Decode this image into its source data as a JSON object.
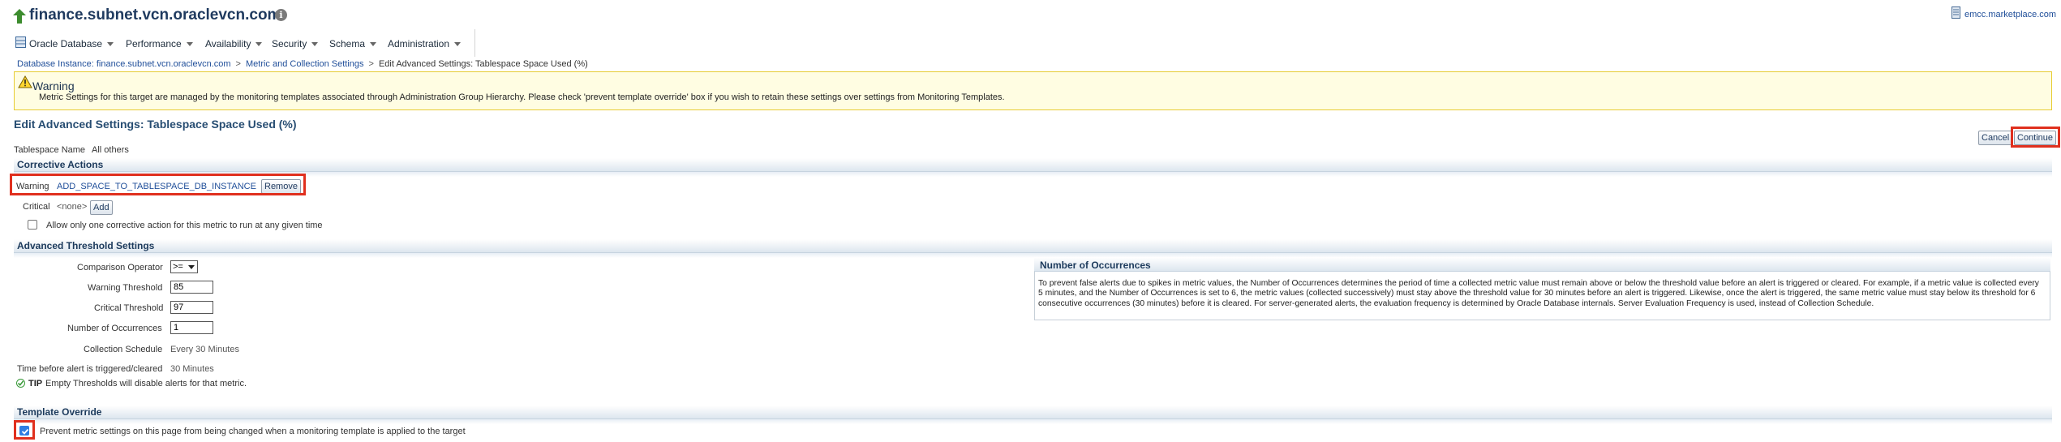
{
  "header": {
    "title": "finance.subnet.vcn.oraclevcn.com",
    "info_glyph": "i",
    "host_link": "emcc.marketplace.com"
  },
  "menu": {
    "items": [
      {
        "label": "Oracle Database",
        "icon": "database-icon"
      },
      {
        "label": "Performance"
      },
      {
        "label": "Availability"
      },
      {
        "label": "Security"
      },
      {
        "label": "Schema"
      },
      {
        "label": "Administration"
      }
    ]
  },
  "breadcrumb": {
    "items": [
      "Database Instance: finance.subnet.vcn.oraclevcn.com",
      "Metric and Collection Settings",
      "Edit Advanced Settings: Tablespace Space Used (%)"
    ],
    "separator": ">"
  },
  "warning": {
    "title": "Warning",
    "message": "Metric Settings for this target are managed by the monitoring templates associated through Administration Group Hierarchy. Please check 'prevent template override' box if you wish to retain these settings over settings from Monitoring Templates."
  },
  "page": {
    "heading": "Edit Advanced Settings: Tablespace Space Used (%)",
    "cancel_label": "Cancel",
    "continue_label": "Continue",
    "tablespace_label": "Tablespace Name",
    "tablespace_value": "All others"
  },
  "corrective_actions": {
    "heading": "Corrective Actions",
    "warning_label": "Warning",
    "warning_action": "ADD_SPACE_TO_TABLESPACE_DB_INSTANCE",
    "remove_label": "Remove",
    "critical_label": "Critical",
    "critical_value": "<none>",
    "add_label": "Add",
    "allow_one_label": "Allow only one corrective action for this metric to run at any given time",
    "allow_one_checked": false
  },
  "thresholds": {
    "heading": "Advanced Threshold Settings",
    "comparison_label": "Comparison Operator",
    "comparison_value": ">=",
    "warning_label": "Warning Threshold",
    "warning_value": "85",
    "critical_label": "Critical Threshold",
    "critical_value": "97",
    "occurrences_label": "Number of Occurrences",
    "occurrences_value": "1",
    "schedule_label": "Collection Schedule",
    "schedule_value": "Every 30 Minutes",
    "time_label": "Time before alert is triggered/cleared",
    "time_value": "30 Minutes",
    "tip_label": "TIP",
    "tip_text": "Empty Thresholds will disable alerts for that metric."
  },
  "occurrences_panel": {
    "title": "Number of Occurrences",
    "text": "To prevent false alerts due to spikes in metric values, the Number of Occurrences determines the period of time a collected metric value must remain above or below the threshold value before an alert is triggered or cleared. For example, if a metric value is collected every 5 minutes, and the Number of Occurrences is set to 6, the metric values (collected successively) must stay above the threshold value for 30 minutes before an alert is triggered. Likewise, once the alert is triggered, the same metric value must stay below its threshold for 6 consecutive occurrences (30 minutes) before it is cleared. For server-generated alerts, the evaluation frequency is determined by Oracle Database internals. Server Evaluation Frequency is used, instead of Collection Schedule."
  },
  "template_override": {
    "heading": "Template Override",
    "prevent_label": "Prevent metric settings on this page from being changed when a monitoring template is applied to the target",
    "prevent_checked": true
  },
  "colors": {
    "highlight_frame": "#e0301e",
    "link": "#1f4e99",
    "warning_bg": "#fffde2"
  }
}
